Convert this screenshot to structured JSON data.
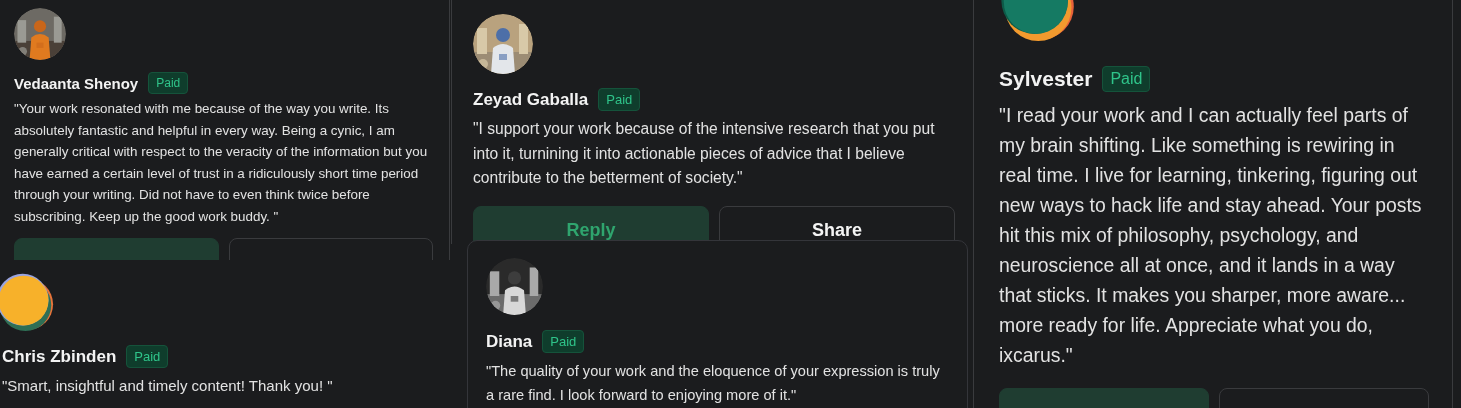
{
  "cards": [
    {
      "name": "Vedaanta Shenoy",
      "badge": "Paid",
      "quote": "\"Your work resonated with me because of the way you write. Its absolutely fantastic and helpful in every way. Being a cynic, I am generally critical with respect to the veracity of the information but you have earned a certain level of trust in a ridiculously short time period through your writing. Did not have to even think twice before subscribing. Keep up the good work buddy. \"",
      "buttons": [
        {
          "kind": "reply"
        },
        {
          "kind": "share"
        }
      ]
    },
    {
      "name": "Zeyad Gaballa",
      "badge": "Paid",
      "quote": "\"I support your work because of the intensive research that you put into it, turnining it into actionable pieces of advice that I believe contribute to the betterment of society.\"",
      "buttons": [
        {
          "kind": "reply",
          "label": "Reply"
        },
        {
          "kind": "share",
          "label": "Share"
        }
      ]
    },
    {
      "avatar": {
        "kind": "generated"
      },
      "name": "Sylvester",
      "badge": "Paid",
      "quote": "\"I read your work and I can actually feel parts of my brain shifting. Like something is rewiring in real time. I live for learning, tinkering, figuring out new ways to hack life and stay ahead. Your posts hit this mix of philosophy, psychology, and neuroscience all at once, and it lands in a way that sticks. It makes you sharper, more aware... more ready for life. Appreciate what you do, ixcarus.\"",
      "buttons": [
        {
          "kind": "reply"
        },
        {
          "kind": "share"
        }
      ]
    },
    {
      "avatar": {
        "kind": "generated"
      },
      "name": "Chris Zbinden",
      "badge": "Paid",
      "quote": "\"Smart, insightful and timely content! Thank you! \""
    },
    {
      "name": "Diana",
      "badge": "Paid",
      "quote": "\"The quality of your work and the eloquence of your expression is truly a rare find. I look forward to enjoying more of it.\""
    }
  ]
}
